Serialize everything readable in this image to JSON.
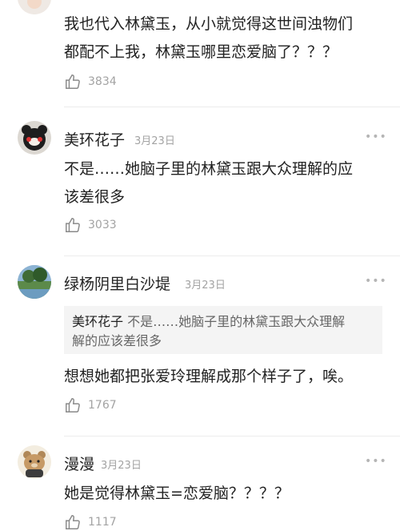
{
  "comments": [
    {
      "username": "",
      "text_line1": "我也代入林黛玉，从小就觉得这世间浊物们",
      "text_line2": "都配不上我，林黛玉哪里恋爱脑了？？？",
      "likes": "3834"
    },
    {
      "username": "美环花子",
      "date": "3月23日",
      "text_line1": "不是……她脑子里的林黛玉跟大众理解的应",
      "text_line2": "该差很多",
      "likes": "3033"
    },
    {
      "username": "绿杨阴里白沙堤",
      "date": "3月23日",
      "quote_author": "美环花子",
      "quote_line1": "不是……她脑子里的林黛玉跟大众理解",
      "quote_line2": "解的应该差很多",
      "text": "想想她都把张爱玲理解成那个样子了，唉。",
      "likes": "1767"
    },
    {
      "username": "漫漫",
      "date": "3月23日",
      "text": "她是觉得林黛玉=恋爱脑？？？？",
      "likes": "1117"
    }
  ],
  "more_glyph": "•••"
}
